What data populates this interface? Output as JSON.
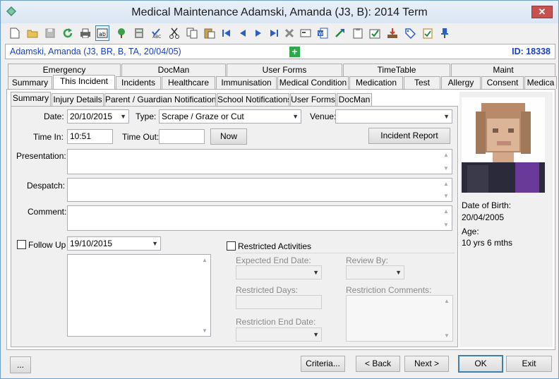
{
  "window": {
    "title": "Medical Maintenance   Adamski, Amanda (J3, B): 2014 Term",
    "close_label": "✕"
  },
  "toolbar": {
    "icons": [
      "new-document-icon",
      "open-folder-icon",
      "save-icon",
      "refresh-icon",
      "print-icon",
      "text-field-icon",
      "tree-icon",
      "calculator-icon",
      "spell-check-icon",
      "cut-icon",
      "copy-icon",
      "paste-icon",
      "first-record-icon",
      "previous-record-icon",
      "next-record-icon",
      "last-record-icon",
      "delete-icon",
      "envelope-icon",
      "word-document-icon",
      "forward-arrow-icon",
      "clipboard-icon",
      "approve-icon",
      "export-tray-icon",
      "tag-icon",
      "checklist-icon",
      "pin-icon"
    ]
  },
  "student": {
    "summary": "Adamski, Amanda (J3, BR, B, TA, 20/04/05)",
    "id_label": "ID: 18338",
    "plus": "+"
  },
  "tabs_row1": [
    "Emergency",
    "DocMan",
    "User Forms",
    "TimeTable",
    "Maint"
  ],
  "tabs_row2": [
    "Summary",
    "This Incident",
    "Incidents",
    "Healthcare",
    "Immunisation",
    "Medical Condition",
    "Medication",
    "Test",
    "Allergy",
    "Consent",
    "Medica"
  ],
  "subtabs": [
    "Summary",
    "Injury Details",
    "Parent / Guardian Notifications",
    "School Notifications",
    "User Forms",
    "DocMan"
  ],
  "form": {
    "date_label": "Date:",
    "date_value": "20/10/2015",
    "type_label": "Type:",
    "type_value": "Scrape / Graze or Cut",
    "venue_label": "Venue:",
    "venue_value": "",
    "time_in_label": "Time In:",
    "time_in_value": "10:51",
    "time_out_label": "Time Out:",
    "time_out_value": "",
    "now_button": "Now",
    "incident_report_button": "Incident Report",
    "presentation_label": "Presentation:",
    "despatch_label": "Despatch:",
    "comment_label": "Comment:",
    "follow_up_label": "Follow Up",
    "follow_up_date": "19/10/2015",
    "restricted_label": "Restricted Activities",
    "expected_end_label": "Expected  End Date:",
    "review_by_label": "Review By:",
    "restricted_days_label": "Restricted Days:",
    "restriction_comments_label": "Restriction  Comments:",
    "restriction_end_label": "Restriction  End Date:"
  },
  "profile": {
    "dob_label": "Date of Birth:",
    "dob_value": "20/04/2005",
    "age_label": "Age:",
    "age_value": "10 yrs 6 mths"
  },
  "footer": {
    "more_button": "...",
    "criteria_button": "Criteria...",
    "back_button": "< Back",
    "next_button": "Next >",
    "ok_button": "OK",
    "exit_button": "Exit"
  }
}
